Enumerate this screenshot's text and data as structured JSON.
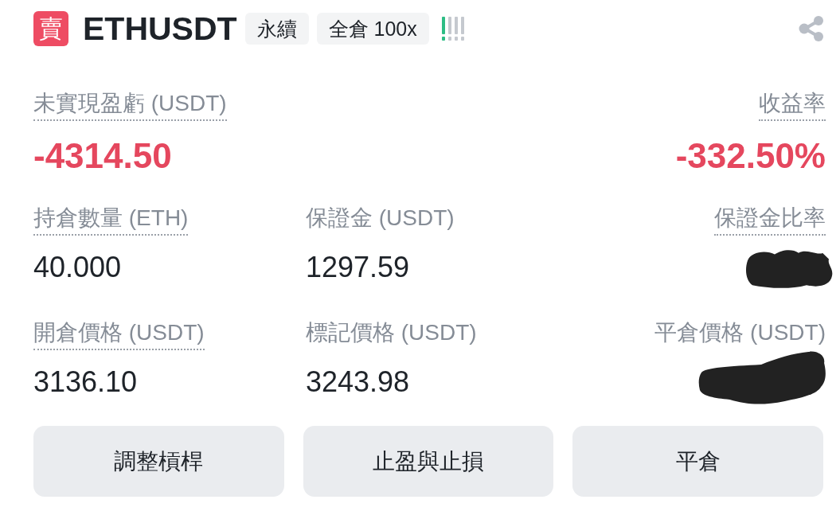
{
  "header": {
    "side_badge": "賣",
    "symbol": "ETHUSDT",
    "tags": [
      "永續",
      "全倉 100x"
    ],
    "risk_meter": {
      "level": 0.25
    }
  },
  "summary": [
    {
      "label": "未實現盈虧 (USDT)",
      "underlined": true,
      "value": "-4314.50",
      "negative": true
    },
    {
      "label": "收益率",
      "underlined": true,
      "value": "-332.50%",
      "negative": true
    }
  ],
  "details": [
    {
      "label": "持倉數量 (ETH)",
      "underlined": true,
      "kind": "value",
      "value": "40.000"
    },
    {
      "label": "保證金 (USDT)",
      "underlined": false,
      "kind": "value",
      "value": "1297.59"
    },
    {
      "label": "保證金比率",
      "underlined": true,
      "kind": "redacted"
    },
    {
      "label": "開倉價格 (USDT)",
      "underlined": true,
      "kind": "value",
      "value": "3136.10"
    },
    {
      "label": "標記價格 (USDT)",
      "underlined": false,
      "kind": "value",
      "value": "3243.98"
    },
    {
      "label": "平倉價格 (USDT)",
      "underlined": false,
      "kind": "redacted"
    }
  ],
  "buttons": [
    "調整槓桿",
    "止盈與止損",
    "平倉"
  ]
}
